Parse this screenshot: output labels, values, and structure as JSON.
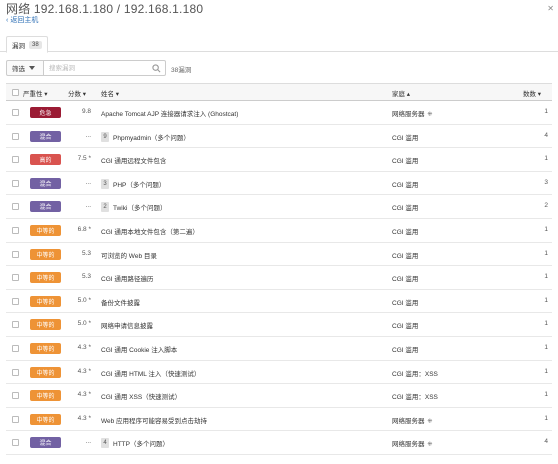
{
  "header": {
    "title": "网络 192.168.1.180 / 192.168.1.180",
    "back_label": "返回主机",
    "close_symbol": "✕"
  },
  "tabs": [
    {
      "label": "漏洞",
      "count": "38"
    }
  ],
  "toolbar": {
    "filter_label": "筛选",
    "search_placeholder": "搜索漏洞",
    "result_count": "38漏洞"
  },
  "table": {
    "columns": {
      "severity": "严重性",
      "score": "分数",
      "name": "姓名",
      "family": "家庭",
      "count": "数数"
    },
    "rows": [
      {
        "severity": "危急",
        "sev_color": "#9b1b34",
        "score": "9.8",
        "group": "",
        "name": "Apache Tomcat AJP 连接器请求注入 (Ghostcat)",
        "family": "网络服务器",
        "fam_icon": "⁜",
        "count": "1"
      },
      {
        "severity": "混合",
        "sev_color": "#7261a3",
        "score": "...",
        "group": "9",
        "name": "Phpmyadmin（多个问题）",
        "family": "CGI 滥用",
        "fam_icon": "",
        "count": "4"
      },
      {
        "severity": "高的",
        "sev_color": "#d9534f",
        "score": "7.5 *",
        "group": "",
        "name": "CGI 通用远程文件包含",
        "family": "CGI 滥用",
        "fam_icon": "",
        "count": "1"
      },
      {
        "severity": "混合",
        "sev_color": "#7261a3",
        "score": "...",
        "group": "3",
        "name": "PHP（多个问题）",
        "family": "CGI 滥用",
        "fam_icon": "",
        "count": "3"
      },
      {
        "severity": "混合",
        "sev_color": "#7261a3",
        "score": "...",
        "group": "2",
        "name": "Twiki（多个问题）",
        "family": "CGI 滥用",
        "fam_icon": "",
        "count": "2"
      },
      {
        "severity": "中等的",
        "sev_color": "#ee9336",
        "score": "6.8 *",
        "group": "",
        "name": "CGI 通用本地文件包含（第二遍）",
        "family": "CGI 滥用",
        "fam_icon": "",
        "count": "1"
      },
      {
        "severity": "中等的",
        "sev_color": "#ee9336",
        "score": "5.3",
        "group": "",
        "name": "可浏览的 Web 目录",
        "family": "CGI 滥用",
        "fam_icon": "",
        "count": "1"
      },
      {
        "severity": "中等的",
        "sev_color": "#ee9336",
        "score": "5.3",
        "group": "",
        "name": "CGI 通用路径遍历",
        "family": "CGI 滥用",
        "fam_icon": "",
        "count": "1"
      },
      {
        "severity": "中等的",
        "sev_color": "#ee9336",
        "score": "5.0 *",
        "group": "",
        "name": "备份文件披露",
        "family": "CGI 滥用",
        "fam_icon": "",
        "count": "1"
      },
      {
        "severity": "中等的",
        "sev_color": "#ee9336",
        "score": "5.0 *",
        "group": "",
        "name": "网络申请信息披露",
        "family": "CGI 滥用",
        "fam_icon": "",
        "count": "1"
      },
      {
        "severity": "中等的",
        "sev_color": "#ee9336",
        "score": "4.3 *",
        "group": "",
        "name": "CGI 通用 Cookie 注入脚本",
        "family": "CGI 滥用",
        "fam_icon": "",
        "count": "1"
      },
      {
        "severity": "中等的",
        "sev_color": "#ee9336",
        "score": "4.3 *",
        "group": "",
        "name": "CGI 通用 HTML 注入（快速测试）",
        "family": "CGI 滥用：XSS",
        "fam_icon": "",
        "count": "1"
      },
      {
        "severity": "中等的",
        "sev_color": "#ee9336",
        "score": "4.3 *",
        "group": "",
        "name": "CGI 通用 XSS（快速测试）",
        "family": "CGI 滥用：XSS",
        "fam_icon": "",
        "count": "1"
      },
      {
        "severity": "中等的",
        "sev_color": "#ee9336",
        "score": "4.3 *",
        "group": "",
        "name": "Web 应用程序可能容易受到点击劫持",
        "family": "网络服务器",
        "fam_icon": "⁜",
        "count": "1"
      },
      {
        "severity": "混合",
        "sev_color": "#7261a3",
        "score": "...",
        "group": "4",
        "name": "HTTP（多个问题）",
        "family": "网络服务器",
        "fam_icon": "⁜",
        "count": "4"
      }
    ]
  }
}
